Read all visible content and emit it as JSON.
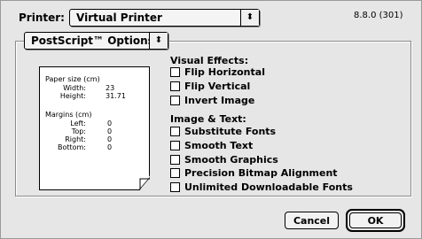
{
  "printer": {
    "label": "Printer:",
    "selected": "Virtual Printer",
    "popup_arrow": "⬍"
  },
  "version": "8.8.0 (301)",
  "panel": {
    "selected": "PostScript™ Options",
    "popup_arrow": "⬍"
  },
  "preview": {
    "paper_size_label": "Paper size (cm)",
    "width_label": "Width:",
    "width_value": "23",
    "height_label": "Height:",
    "height_value": "31.71",
    "margins_label": "Margins (cm)",
    "left_label": "Left:",
    "left_value": "0",
    "top_label": "Top:",
    "top_value": "0",
    "right_label": "Right:",
    "right_value": "0",
    "bottom_label": "Bottom:",
    "bottom_value": "0"
  },
  "visual_effects": {
    "title": "Visual Effects:",
    "options": [
      "Flip Horizontal",
      "Flip Vertical",
      "Invert Image"
    ]
  },
  "image_text": {
    "title": "Image & Text:",
    "options": [
      "Substitute Fonts",
      "Smooth Text",
      "Smooth Graphics",
      "Precision Bitmap Alignment",
      "Unlimited Downloadable Fonts"
    ]
  },
  "buttons": {
    "cancel": "Cancel",
    "ok": "OK"
  },
  "checked": {
    "flip_horizontal": false,
    "flip_vertical": false,
    "invert_image": false,
    "substitute_fonts": false,
    "smooth_text": false,
    "smooth_graphics": false,
    "precision_bitmap_alignment": false,
    "unlimited_downloadable_fonts": false
  }
}
